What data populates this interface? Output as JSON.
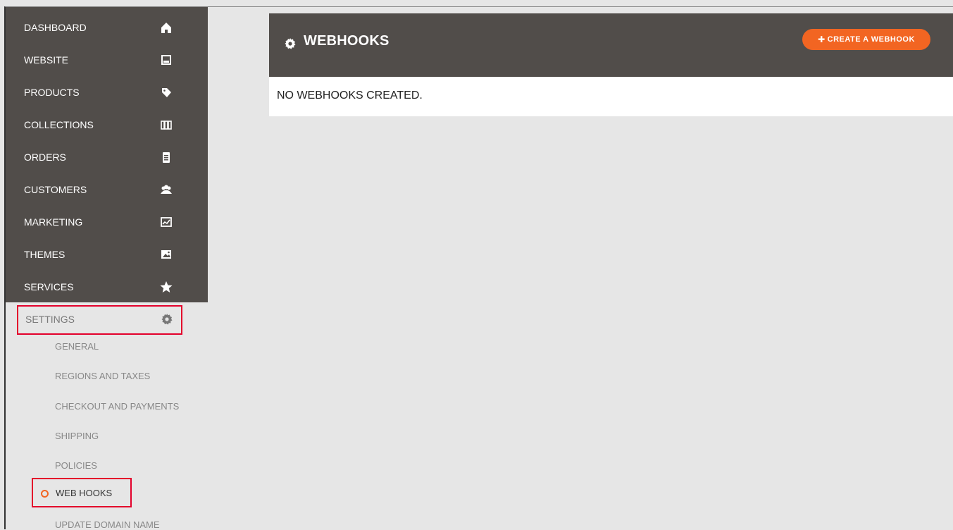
{
  "sidebar": {
    "items": [
      {
        "label": "DASHBOARD",
        "icon": "home-icon"
      },
      {
        "label": "WEBSITE",
        "icon": "website-icon"
      },
      {
        "label": "PRODUCTS",
        "icon": "tag-icon"
      },
      {
        "label": "COLLECTIONS",
        "icon": "collections-icon"
      },
      {
        "label": "ORDERS",
        "icon": "clipboard-icon"
      },
      {
        "label": "CUSTOMERS",
        "icon": "users-icon"
      },
      {
        "label": "MARKETING",
        "icon": "chart-icon"
      },
      {
        "label": "THEMES",
        "icon": "image-icon"
      },
      {
        "label": "SERVICES",
        "icon": "star-icon"
      }
    ],
    "settings": {
      "label": "SETTINGS",
      "icon": "gear-icon"
    },
    "submenu": [
      {
        "label": "GENERAL"
      },
      {
        "label": "REGIONS AND TAXES"
      },
      {
        "label": "CHECKOUT AND PAYMENTS"
      },
      {
        "label": "SHIPPING"
      },
      {
        "label": "POLICIES"
      },
      {
        "label": "WEB HOOKS",
        "active": true
      },
      {
        "label": "UPDATE DOMAIN NAME"
      }
    ]
  },
  "header": {
    "title": "WEBHOOKS",
    "create_button": "CREATE A WEBHOOK"
  },
  "content": {
    "message": "NO WEBHOOKS CREATED."
  },
  "colors": {
    "sidebar_bg": "#514d4a",
    "accent": "#f26522",
    "highlight_border": "#e3002b"
  }
}
